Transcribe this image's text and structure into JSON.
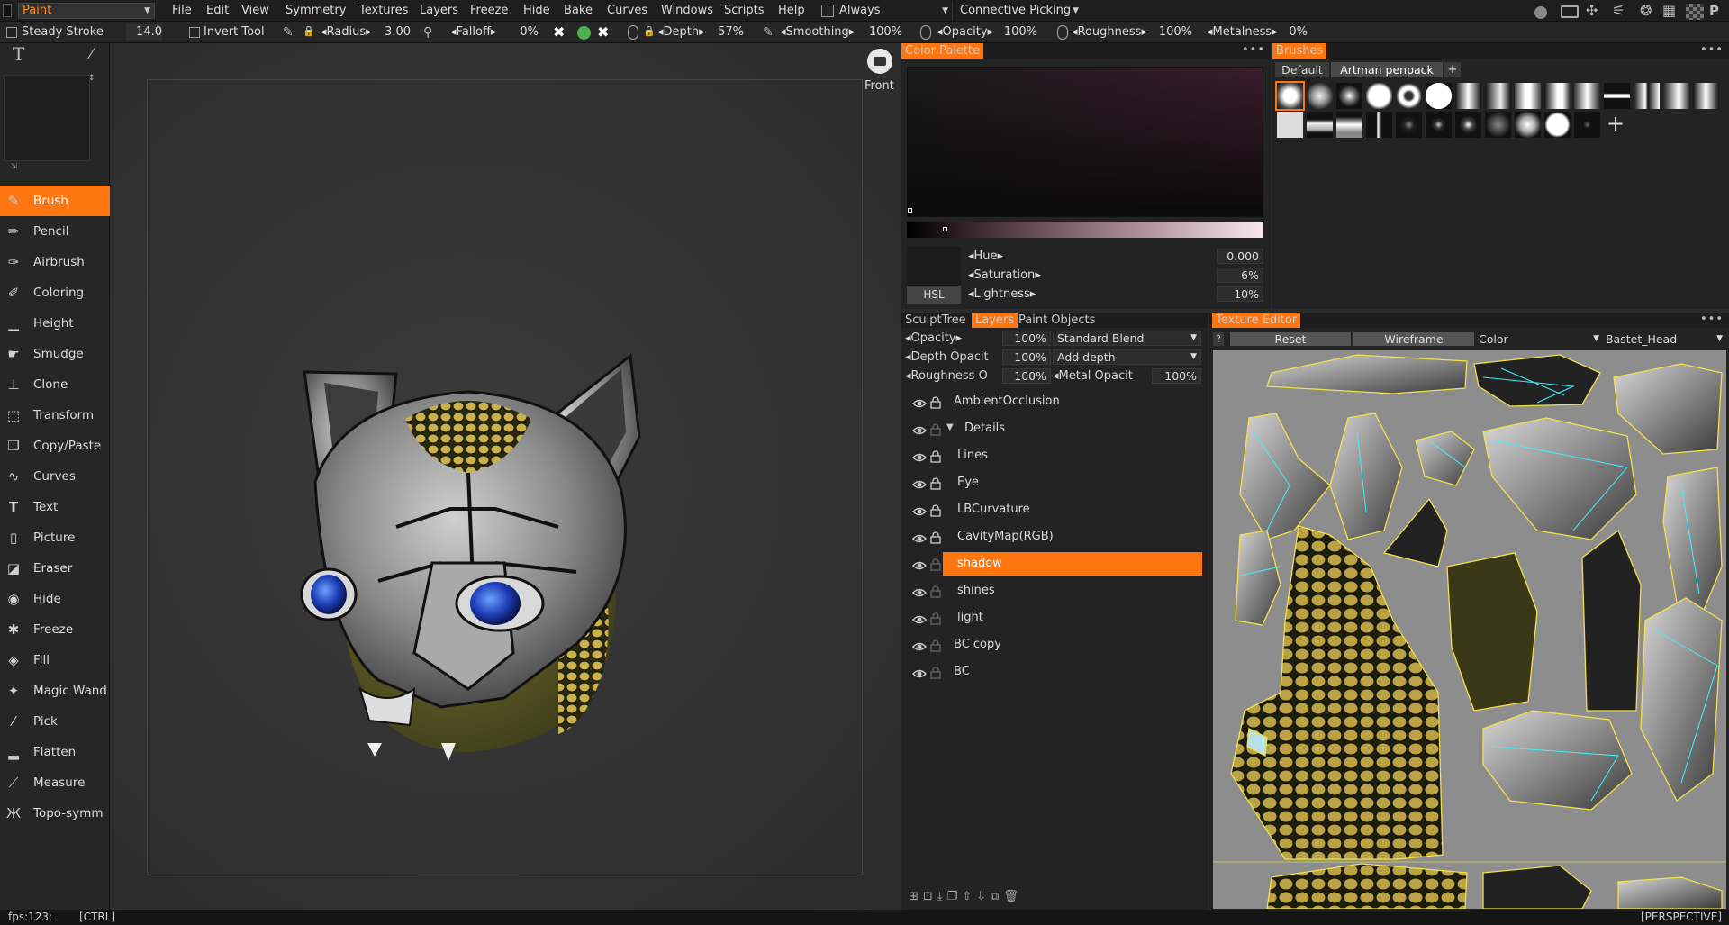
{
  "app": {
    "mode": "Paint"
  },
  "menu": {
    "items": [
      "File",
      "Edit",
      "View",
      "Symmetry",
      "Textures",
      "Layers",
      "Freeze",
      "Hide",
      "Bake",
      "Curves",
      "Windows",
      "Scripts",
      "Help"
    ],
    "always_label": "Always",
    "picking": "Connective  Picking"
  },
  "toolbar": {
    "steady_stroke": "Steady  Stroke",
    "steady_value": "14.0",
    "invert_tool": "Invert  Tool",
    "radius": "Radius",
    "radius_value": "3.00",
    "falloff": "Falloff",
    "falloff_value": "0%",
    "depth": "Depth",
    "depth_value": "57%",
    "smoothing": "Smoothing",
    "smoothing_value": "100%",
    "opacity": "Opacity",
    "opacity_value": "100%",
    "roughness": "Roughness",
    "roughness_value": "100%",
    "metalness": "Metalness",
    "metalness_value": "0%"
  },
  "tools": [
    "Brush",
    "Pencil",
    "Airbrush",
    "Coloring",
    "Height",
    "Smudge",
    "Clone",
    "Transform",
    "Copy/Paste",
    "Curves",
    "Text",
    "Picture",
    "Eraser",
    "Hide",
    "Freeze",
    "Fill",
    "Magic  Wand",
    "Pick",
    "Flatten",
    "Measure",
    "Topo-symm"
  ],
  "viewport": {
    "view_label": "Front"
  },
  "color_palette": {
    "title": "Color  Palette",
    "mode": "HSL",
    "hue_label": "Hue",
    "hue_value": "0.000",
    "sat_label": "Saturation",
    "sat_value": "6%",
    "light_label": "Lightness",
    "light_value": "10%",
    "menu": "•••"
  },
  "brushes": {
    "title": "Brushes",
    "tabs": [
      "Default",
      "Artman  penpack"
    ],
    "add": "+",
    "menu": "•••"
  },
  "layers_panel": {
    "tabs": [
      "SculptTree",
      "Layers",
      "Paint  Objects"
    ],
    "props": [
      {
        "label": "Opacity",
        "value": "100%",
        "mode": "Standard  Blend"
      },
      {
        "label": "Depth  Opacit",
        "value": "100%",
        "mode": "Add  depth"
      },
      {
        "label": "Roughness  O",
        "value": "100%",
        "mode": "Metal  Opacit",
        "mode_value": "100%"
      }
    ],
    "layers": [
      {
        "name": "AmbientOcclusion",
        "indent": 0
      },
      {
        "name": "Details",
        "indent": 0,
        "group": true
      },
      {
        "name": "Lines",
        "indent": 1
      },
      {
        "name": "Eye",
        "indent": 1
      },
      {
        "name": "LBCurvature",
        "indent": 1
      },
      {
        "name": "CavityMap(RGB)",
        "indent": 1
      },
      {
        "name": "shadow",
        "indent": 1,
        "selected": true
      },
      {
        "name": "shines",
        "indent": 1
      },
      {
        "name": "light",
        "indent": 1
      },
      {
        "name": "BC  copy",
        "indent": 0
      },
      {
        "name": "BC",
        "indent": 0
      }
    ]
  },
  "texture_editor": {
    "title": "Texture  Editor",
    "help": "?",
    "reset": "Reset",
    "wireframe": "Wireframe",
    "channel": "Color",
    "object": "Bastet_Head",
    "menu": "•••"
  },
  "status": {
    "fps": "fps:123;",
    "key": "[CTRL]",
    "projection": "[PERSPECTIVE]"
  }
}
